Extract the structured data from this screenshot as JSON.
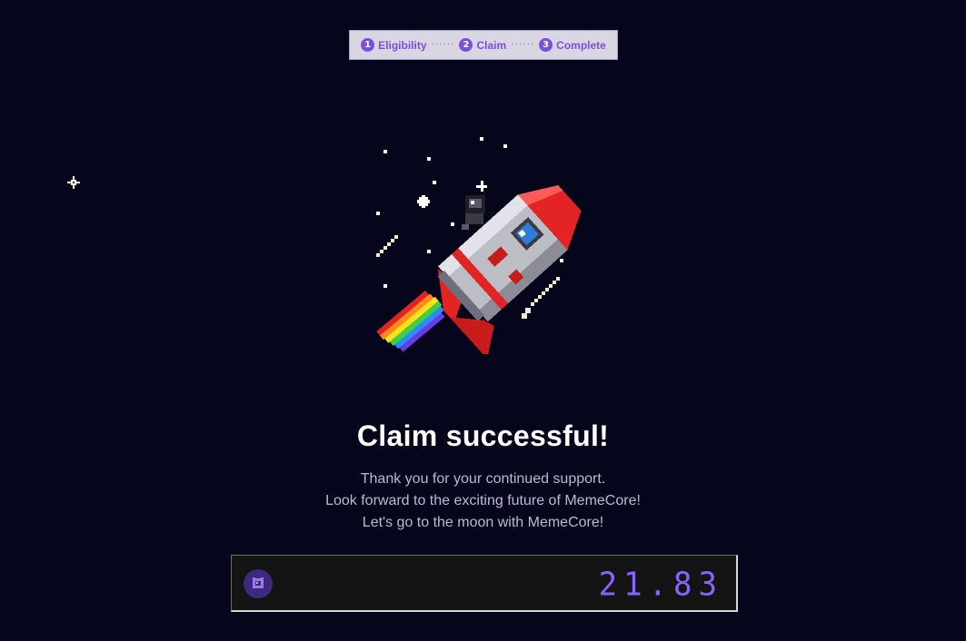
{
  "stepper": {
    "steps": [
      {
        "num": "1",
        "label": "Eligibility"
      },
      {
        "num": "2",
        "label": "Claim"
      },
      {
        "num": "3",
        "label": "Complete"
      }
    ],
    "separator": "······"
  },
  "result": {
    "title": "Claim successful!",
    "lines": [
      "Thank you for your continued support.",
      "Look forward to the exciting future of MemeCore!",
      "Let's go to the moon with MemeCore!"
    ]
  },
  "balance": {
    "amount": "21.83",
    "token_icon": "memecore-coin-icon"
  },
  "colors": {
    "background": "#05051c",
    "accent": "#7a4fe0",
    "amount": "#8a63ff"
  }
}
